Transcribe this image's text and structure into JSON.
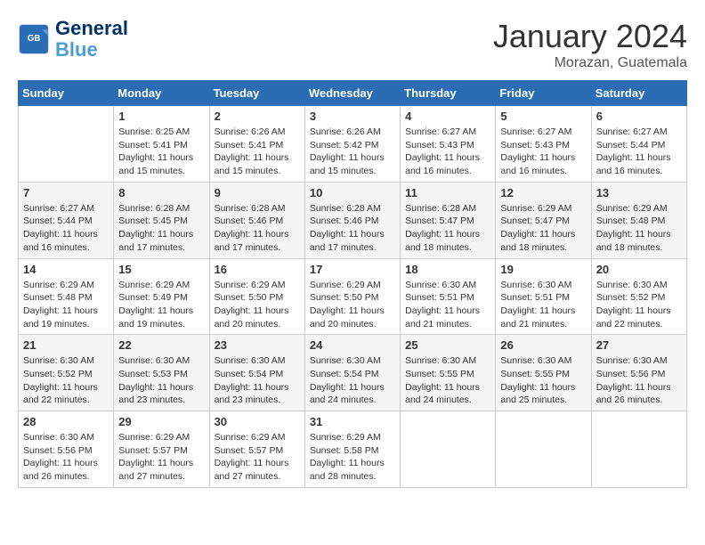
{
  "header": {
    "logo_line1": "General",
    "logo_line2": "Blue",
    "month": "January 2024",
    "location": "Morazan, Guatemala"
  },
  "weekdays": [
    "Sunday",
    "Monday",
    "Tuesday",
    "Wednesday",
    "Thursday",
    "Friday",
    "Saturday"
  ],
  "weeks": [
    [
      {
        "day": "",
        "sunrise": "",
        "sunset": "",
        "daylight": ""
      },
      {
        "day": "1",
        "sunrise": "Sunrise: 6:25 AM",
        "sunset": "Sunset: 5:41 PM",
        "daylight": "Daylight: 11 hours and 15 minutes."
      },
      {
        "day": "2",
        "sunrise": "Sunrise: 6:26 AM",
        "sunset": "Sunset: 5:41 PM",
        "daylight": "Daylight: 11 hours and 15 minutes."
      },
      {
        "day": "3",
        "sunrise": "Sunrise: 6:26 AM",
        "sunset": "Sunset: 5:42 PM",
        "daylight": "Daylight: 11 hours and 15 minutes."
      },
      {
        "day": "4",
        "sunrise": "Sunrise: 6:27 AM",
        "sunset": "Sunset: 5:43 PM",
        "daylight": "Daylight: 11 hours and 16 minutes."
      },
      {
        "day": "5",
        "sunrise": "Sunrise: 6:27 AM",
        "sunset": "Sunset: 5:43 PM",
        "daylight": "Daylight: 11 hours and 16 minutes."
      },
      {
        "day": "6",
        "sunrise": "Sunrise: 6:27 AM",
        "sunset": "Sunset: 5:44 PM",
        "daylight": "Daylight: 11 hours and 16 minutes."
      }
    ],
    [
      {
        "day": "7",
        "sunrise": "Sunrise: 6:27 AM",
        "sunset": "Sunset: 5:44 PM",
        "daylight": "Daylight: 11 hours and 16 minutes."
      },
      {
        "day": "8",
        "sunrise": "Sunrise: 6:28 AM",
        "sunset": "Sunset: 5:45 PM",
        "daylight": "Daylight: 11 hours and 17 minutes."
      },
      {
        "day": "9",
        "sunrise": "Sunrise: 6:28 AM",
        "sunset": "Sunset: 5:46 PM",
        "daylight": "Daylight: 11 hours and 17 minutes."
      },
      {
        "day": "10",
        "sunrise": "Sunrise: 6:28 AM",
        "sunset": "Sunset: 5:46 PM",
        "daylight": "Daylight: 11 hours and 17 minutes."
      },
      {
        "day": "11",
        "sunrise": "Sunrise: 6:28 AM",
        "sunset": "Sunset: 5:47 PM",
        "daylight": "Daylight: 11 hours and 18 minutes."
      },
      {
        "day": "12",
        "sunrise": "Sunrise: 6:29 AM",
        "sunset": "Sunset: 5:47 PM",
        "daylight": "Daylight: 11 hours and 18 minutes."
      },
      {
        "day": "13",
        "sunrise": "Sunrise: 6:29 AM",
        "sunset": "Sunset: 5:48 PM",
        "daylight": "Daylight: 11 hours and 18 minutes."
      }
    ],
    [
      {
        "day": "14",
        "sunrise": "Sunrise: 6:29 AM",
        "sunset": "Sunset: 5:48 PM",
        "daylight": "Daylight: 11 hours and 19 minutes."
      },
      {
        "day": "15",
        "sunrise": "Sunrise: 6:29 AM",
        "sunset": "Sunset: 5:49 PM",
        "daylight": "Daylight: 11 hours and 19 minutes."
      },
      {
        "day": "16",
        "sunrise": "Sunrise: 6:29 AM",
        "sunset": "Sunset: 5:50 PM",
        "daylight": "Daylight: 11 hours and 20 minutes."
      },
      {
        "day": "17",
        "sunrise": "Sunrise: 6:29 AM",
        "sunset": "Sunset: 5:50 PM",
        "daylight": "Daylight: 11 hours and 20 minutes."
      },
      {
        "day": "18",
        "sunrise": "Sunrise: 6:30 AM",
        "sunset": "Sunset: 5:51 PM",
        "daylight": "Daylight: 11 hours and 21 minutes."
      },
      {
        "day": "19",
        "sunrise": "Sunrise: 6:30 AM",
        "sunset": "Sunset: 5:51 PM",
        "daylight": "Daylight: 11 hours and 21 minutes."
      },
      {
        "day": "20",
        "sunrise": "Sunrise: 6:30 AM",
        "sunset": "Sunset: 5:52 PM",
        "daylight": "Daylight: 11 hours and 22 minutes."
      }
    ],
    [
      {
        "day": "21",
        "sunrise": "Sunrise: 6:30 AM",
        "sunset": "Sunset: 5:52 PM",
        "daylight": "Daylight: 11 hours and 22 minutes."
      },
      {
        "day": "22",
        "sunrise": "Sunrise: 6:30 AM",
        "sunset": "Sunset: 5:53 PM",
        "daylight": "Daylight: 11 hours and 23 minutes."
      },
      {
        "day": "23",
        "sunrise": "Sunrise: 6:30 AM",
        "sunset": "Sunset: 5:54 PM",
        "daylight": "Daylight: 11 hours and 23 minutes."
      },
      {
        "day": "24",
        "sunrise": "Sunrise: 6:30 AM",
        "sunset": "Sunset: 5:54 PM",
        "daylight": "Daylight: 11 hours and 24 minutes."
      },
      {
        "day": "25",
        "sunrise": "Sunrise: 6:30 AM",
        "sunset": "Sunset: 5:55 PM",
        "daylight": "Daylight: 11 hours and 24 minutes."
      },
      {
        "day": "26",
        "sunrise": "Sunrise: 6:30 AM",
        "sunset": "Sunset: 5:55 PM",
        "daylight": "Daylight: 11 hours and 25 minutes."
      },
      {
        "day": "27",
        "sunrise": "Sunrise: 6:30 AM",
        "sunset": "Sunset: 5:56 PM",
        "daylight": "Daylight: 11 hours and 26 minutes."
      }
    ],
    [
      {
        "day": "28",
        "sunrise": "Sunrise: 6:30 AM",
        "sunset": "Sunset: 5:56 PM",
        "daylight": "Daylight: 11 hours and 26 minutes."
      },
      {
        "day": "29",
        "sunrise": "Sunrise: 6:29 AM",
        "sunset": "Sunset: 5:57 PM",
        "daylight": "Daylight: 11 hours and 27 minutes."
      },
      {
        "day": "30",
        "sunrise": "Sunrise: 6:29 AM",
        "sunset": "Sunset: 5:57 PM",
        "daylight": "Daylight: 11 hours and 27 minutes."
      },
      {
        "day": "31",
        "sunrise": "Sunrise: 6:29 AM",
        "sunset": "Sunset: 5:58 PM",
        "daylight": "Daylight: 11 hours and 28 minutes."
      },
      {
        "day": "",
        "sunrise": "",
        "sunset": "",
        "daylight": ""
      },
      {
        "day": "",
        "sunrise": "",
        "sunset": "",
        "daylight": ""
      },
      {
        "day": "",
        "sunrise": "",
        "sunset": "",
        "daylight": ""
      }
    ]
  ]
}
